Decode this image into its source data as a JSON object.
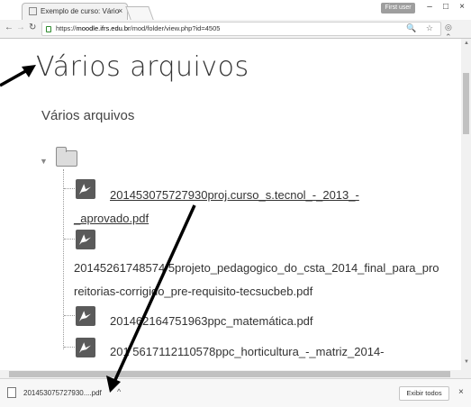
{
  "browser": {
    "tab_title": "Exemplo de curso: Vário",
    "tab_close": "×",
    "user_badge": "First user",
    "window_min": "–",
    "window_max": "□",
    "window_close": "×",
    "url_prefix": "https://",
    "url_host": "moodle.ifrs.edu.br",
    "url_path": "/mod/folder/view.php?id=4505",
    "omnibox_icons": "🔍 ☆",
    "extension_icons": "◎ ⌃ ⋮"
  },
  "page": {
    "title": "Vários arquivos",
    "section_title": "Vários arquivos",
    "files": [
      {
        "line1": "201453075727930proj.curso_s.tecnol_-_2013_-",
        "line2": "_aprovado.pdf"
      },
      {
        "line1": "20145261748574 5projeto_pedagogico_do_csta_2014_final_para_pro",
        "line2": "reitorias-corrigido_pre-requisito-tecsucbeb.pdf"
      },
      {
        "line1": "201462164751963ppc_matemática.pdf"
      },
      {
        "line1": "201 5617112110578ppc_horticultura_-_matriz_2014-"
      }
    ]
  },
  "download_bar": {
    "file_name": "201453075727930....pdf",
    "caret": "^",
    "show_all_label": "Exibir todos",
    "close": "×"
  }
}
